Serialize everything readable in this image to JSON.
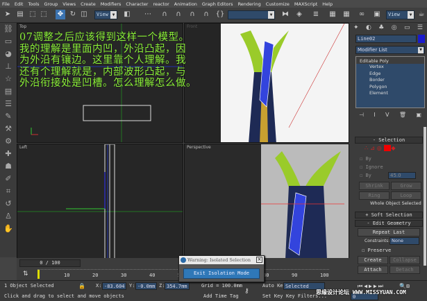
{
  "menu": [
    "File",
    "Edit",
    "Tools",
    "Group",
    "Views",
    "Create",
    "Modifiers",
    "Character",
    "reactor",
    "Animation",
    "Graph Editors",
    "Rendering",
    "Customize",
    "MAXScript",
    "Help"
  ],
  "toolbar": {
    "ref_coord": "View",
    "ref_coord2": "View",
    "named_selection": ""
  },
  "viewports": {
    "top": "Top",
    "front": "Front",
    "left": "Left",
    "perspective": "Perspective"
  },
  "overlay_text": [
    "07调整之后应该得到这样一个模型。",
    "我的理解是里面内凹，外沿凸起，因",
    "为外沿有镶边。这里靠个人理解。我",
    "还有个理解就是，内部波形凸起，与",
    "外沿衔接处是凹槽。怎么理解怎么做。"
  ],
  "command_panel": {
    "object_name": "Line02",
    "object_color": "#1a1acc",
    "modifier_list": "Modifier List",
    "stack": [
      "Editable Poly",
      "Vertex",
      "Edge",
      "Border",
      "Polygon",
      "Element"
    ],
    "selection": {
      "title": "Selection",
      "by_vertex": "By",
      "ignore": "Ignore",
      "by_angle": "By",
      "angle": "45.0",
      "shrink": "Shrink",
      "grow": "Grow",
      "ring": "Ring",
      "loop": "Loop",
      "status": "Whole Object Selected"
    },
    "soft_selection": "Soft Selection",
    "edit_geometry": "Edit Geometry",
    "repeat_last": "Repeat Last",
    "constraints_label": "Constraints:",
    "constraints": "None",
    "preserve": "Preserve",
    "create": "Create",
    "collapse": "Collapse",
    "attach": "Attach",
    "detach": "Detach"
  },
  "timeline": {
    "frame": "0 / 100",
    "ticks": [
      "10",
      "20",
      "30",
      "40",
      "50",
      "60",
      "70",
      "80",
      "90",
      "100"
    ]
  },
  "dialog": {
    "title": "Warning: Isolated Selection",
    "button": "Exit Isolation Mode"
  },
  "status": {
    "selected": "1 Object Selected",
    "x_label": "X:",
    "x": "-83.604",
    "y_label": "Y:",
    "y": "-0.0mm",
    "z_label": "Z:",
    "z": "354.7mm",
    "grid": "Grid = 100.0mm",
    "prompt": "Click and drag to select and move objects",
    "add_time_tag": "Add Time Tag",
    "auto_key": "Auto Key",
    "selected_set": "Selected",
    "set_key": "Set Key",
    "key_filters": "Key Filters...",
    "frame_value": "0"
  },
  "watermark": "思缘设计论坛 WWW.MISSYUAN.COM"
}
